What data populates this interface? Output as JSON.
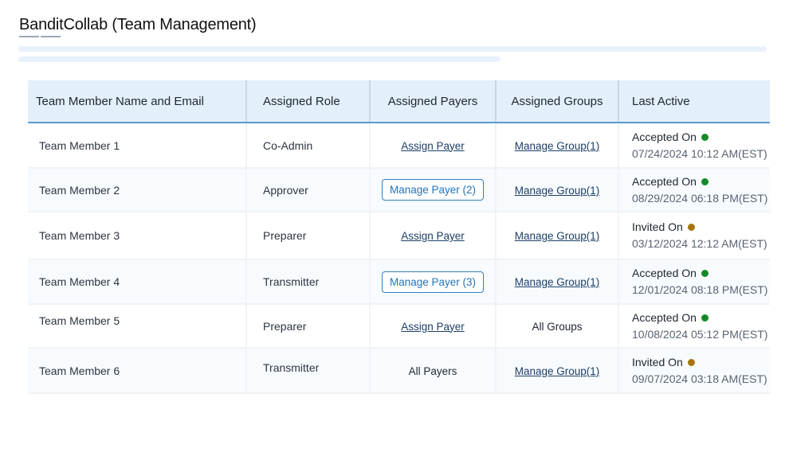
{
  "header": {
    "title": "BanditCollab (Team Management)"
  },
  "colors": {
    "accepted": "#138a28",
    "invited": "#a7760f",
    "accent": "#2f7fc0",
    "header_bg": "#e3effb"
  },
  "table": {
    "columns": [
      "Team Member Name and Email",
      "Assigned Role",
      "Assigned Payers",
      "Assigned Groups",
      "Last Active"
    ],
    "rows": [
      {
        "name": "Team Member 1",
        "role": "Co-Admin",
        "payers": "Assign Payer",
        "payers_type": "link",
        "groups": "Manage Group(1)",
        "groups_type": "link",
        "status": "Accepted On",
        "status_icon": "green-dot",
        "date": "07/24/2024 10:12 AM(EST)"
      },
      {
        "name": "Team Member 2",
        "role": "Approver",
        "payers": "Manage Payer (2)",
        "payers_type": "button",
        "groups": "Manage Group(1)",
        "groups_type": "link",
        "status": "Accepted On",
        "status_icon": "green-dot",
        "date": "08/29/2024 06:18 PM(EST)"
      },
      {
        "name": "Team Member 3",
        "role": "Preparer",
        "payers": "Assign Payer",
        "payers_type": "link",
        "groups": "Manage Group(1)",
        "groups_type": "link",
        "status": "Invited On",
        "status_icon": "amber-dot",
        "date": "03/12/2024 12:12 AM(EST)"
      },
      {
        "name": "Team Member 4",
        "role": "Transmitter",
        "payers": "Manage Payer (3)",
        "payers_type": "button",
        "groups": "Manage Group(1)",
        "groups_type": "link",
        "status": "Accepted On",
        "status_icon": "green-dot",
        "date": "12/01/2024 08:18 PM(EST)"
      },
      {
        "name": "Team Member 5",
        "role": "Preparer",
        "payers": "Assign Payer",
        "payers_type": "link",
        "groups": "All Groups",
        "groups_type": "text",
        "status": "Accepted On",
        "status_icon": "green-dot",
        "date": "10/08/2024 05:12 PM(EST)"
      },
      {
        "name": "Team Member 6",
        "role": "Transmitter",
        "payers": "All Payers",
        "payers_type": "text",
        "groups": "Manage Group(1)",
        "groups_type": "link",
        "status": "Invited On",
        "status_icon": "amber-dot",
        "date": "09/07/2024 03:18 AM(EST)"
      }
    ]
  }
}
